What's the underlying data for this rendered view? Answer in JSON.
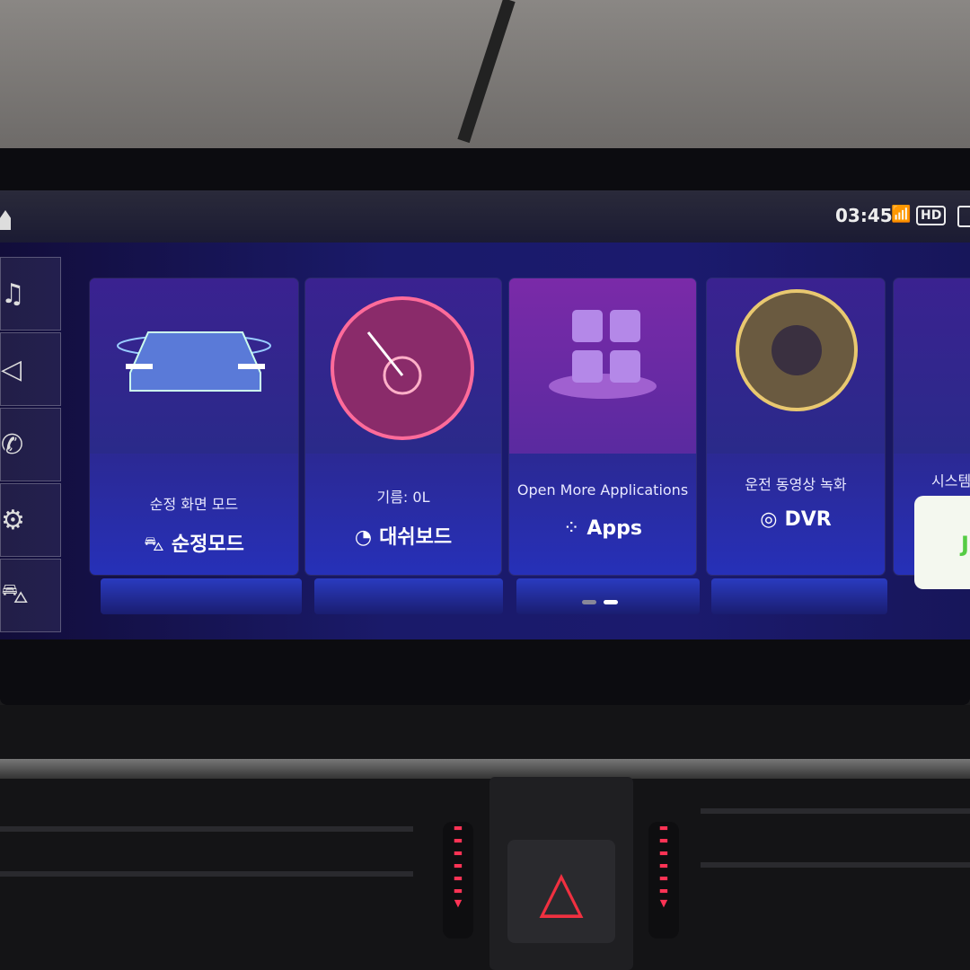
{
  "status": {
    "time": "03:45",
    "hd_badge": "HD",
    "wifi_icon": "wifi-icon"
  },
  "sidebar": {
    "items": [
      {
        "icon": "music-icon",
        "glyph": "♫"
      },
      {
        "icon": "navigation-icon",
        "glyph": "◁"
      },
      {
        "icon": "phone-icon",
        "glyph": "✆"
      },
      {
        "icon": "settings-icon",
        "glyph": "⚙"
      },
      {
        "icon": "car-icon",
        "glyph": "⛍"
      }
    ]
  },
  "cards": [
    {
      "sub": "순정 화면 모드",
      "icon": "car-icon",
      "icon_glyph": "⛍",
      "label": "순정모드"
    },
    {
      "sub": "기름: 0L",
      "icon": "speedometer-icon",
      "icon_glyph": "◔",
      "label": "대쉬보드"
    },
    {
      "sub": "Open More Applications",
      "icon": "apps-icon",
      "icon_glyph": "⁘",
      "label": "Apps"
    },
    {
      "sub": "운전 동영상 녹화",
      "icon": "camera-lens-icon",
      "icon_glyph": "◎",
      "label": "DVR"
    },
    {
      "sub": "시스템",
      "tile_text": "J"
    }
  ],
  "colors": {
    "accent": "#2630b8",
    "hazard": "#f03040"
  }
}
